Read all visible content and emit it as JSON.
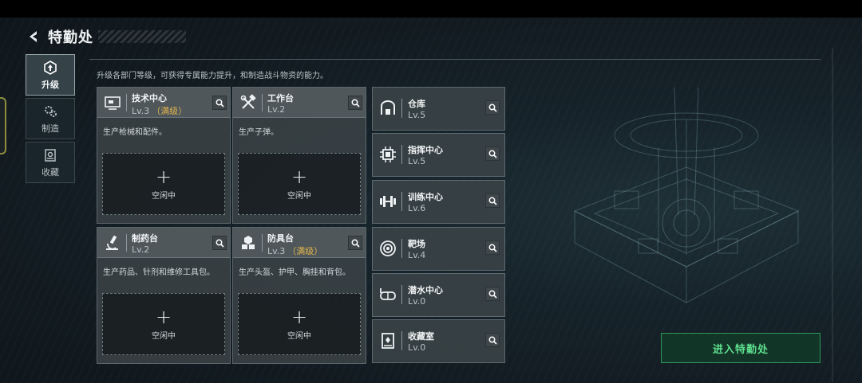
{
  "header": {
    "title": "特勤处"
  },
  "sidebar": {
    "items": [
      {
        "label": "升级",
        "icon": "upgrade-icon",
        "active": true
      },
      {
        "label": "制造",
        "icon": "gears-icon",
        "active": false
      },
      {
        "label": "收藏",
        "icon": "collection-icon",
        "active": false
      }
    ]
  },
  "description": "升级各部门等级，可获得专属能力提升，和制造战斗物资的能力。",
  "workstations": [
    {
      "name": "技术中心",
      "level": "Lv.3",
      "max_tag": "（满级）",
      "desc": "生产枪械和配件。",
      "slot_label": "空闲中",
      "icon": "monitor-icon"
    },
    {
      "name": "工作台",
      "level": "Lv.2",
      "max_tag": "",
      "desc": "生产子弹。",
      "slot_label": "空闲中",
      "icon": "hammer-wrench-icon"
    },
    {
      "name": "制药台",
      "level": "Lv.2",
      "max_tag": "",
      "desc": "生产药品、针剂和维修工具包。",
      "slot_label": "空闲中",
      "icon": "microscope-icon"
    },
    {
      "name": "防具台",
      "level": "Lv.3",
      "max_tag": "（满级）",
      "desc": "生产头盔、护甲、胸挂和背包。",
      "slot_label": "空闲中",
      "icon": "armor-blocks-icon"
    }
  ],
  "facilities": [
    {
      "name": "仓库",
      "level": "Lv.5",
      "icon": "warehouse-icon"
    },
    {
      "name": "指挥中心",
      "level": "Lv.5",
      "icon": "chip-icon"
    },
    {
      "name": "训练中心",
      "level": "Lv.6",
      "icon": "dumbbell-icon"
    },
    {
      "name": "靶场",
      "level": "Lv.4",
      "icon": "target-icon"
    },
    {
      "name": "潜水中心",
      "level": "Lv.0",
      "icon": "diving-mask-icon"
    },
    {
      "name": "收藏室",
      "level": "Lv.0",
      "icon": "display-case-icon"
    }
  ],
  "enter_button": "进入特勤处",
  "colors": {
    "accent_green": "#5fe08f",
    "max_level": "#e0b34c",
    "card_bg": "#3a4246"
  }
}
